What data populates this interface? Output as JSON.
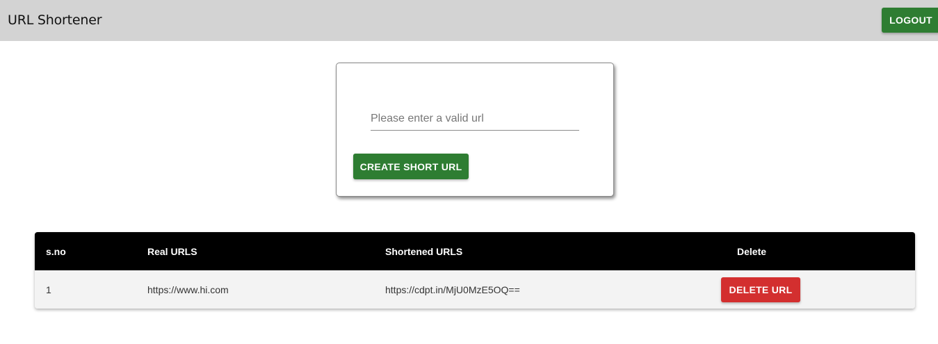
{
  "header": {
    "title": "URL Shortener",
    "logout_label": "LOGOUT"
  },
  "form": {
    "url_placeholder": "Please enter a valid url",
    "url_value": "",
    "create_label": "CREATE SHORT URL"
  },
  "table": {
    "columns": [
      "s.no",
      "Real URLS",
      "Shortened URLS",
      "Delete"
    ],
    "rows": [
      {
        "sno": "1",
        "real_url": "https://www.hi.com",
        "short_url": "https://cdpt.in/MjU0MzE5OQ==",
        "delete_label": "DELETE URL"
      }
    ]
  },
  "colors": {
    "navbar": "#d3d3d3",
    "primary_green": "#2e7d32",
    "danger_red": "#d32f2f",
    "table_header": "#000000",
    "row_bg": "#f3f3f3"
  }
}
